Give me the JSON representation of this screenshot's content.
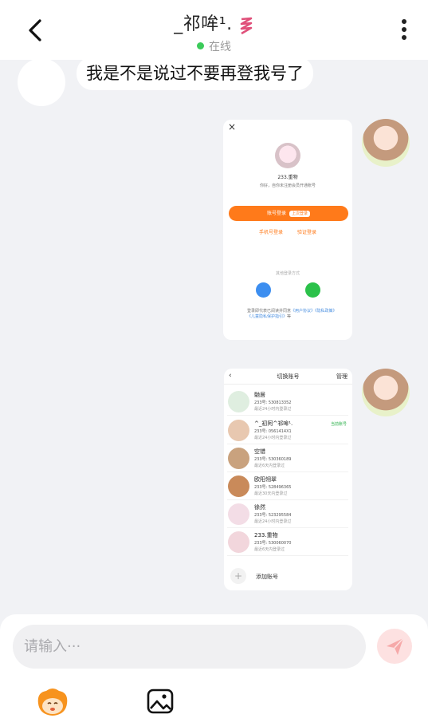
{
  "header": {
    "title": "_祁哞¹.",
    "status": "在线"
  },
  "messages": {
    "incoming_text": "我是不是说过不要再登我号了"
  },
  "screenshot1": {
    "close": "×",
    "name": "233.重物",
    "note": "你好，自你未注册会员开通账号",
    "primary_button": "账号登录",
    "primary_tag": "上次登录",
    "link_phone": "手机号登录",
    "link_verify": "验证登录",
    "other_login": "其他登录方式",
    "legal_prefix": "登录即代表已阅读并同意",
    "legal_links": "《用户协议》《隐私政策》《儿童隐私保护指引》",
    "legal_suffix": "等"
  },
  "screenshot2": {
    "back": "‹",
    "title": "切换账号",
    "manage": "管理",
    "accounts": [
      {
        "name": "馳居",
        "id": "233号: 530813352",
        "time": "最近24小时内登录过",
        "current": ""
      },
      {
        "name": "^_初阿^祁哞¹.",
        "id": "233号: 0561414X1",
        "time": "最近24小时内登录过",
        "current": "当前账号"
      },
      {
        "name": "空错",
        "id": "233号: 530360189",
        "time": "最近6天内登录过",
        "current": ""
      },
      {
        "name": "欧阳翎翠",
        "id": "233号: 528496365",
        "time": "最近30天内登录过",
        "current": ""
      },
      {
        "name": "徐然",
        "id": "233号: 523295584",
        "time": "最近24小时内登录过",
        "current": ""
      },
      {
        "name": "233.重物",
        "id": "233号: 530060070",
        "time": "最近6天内登录过",
        "current": ""
      }
    ],
    "add_account": "添加账号"
  },
  "composer": {
    "placeholder": "请输入···"
  },
  "icons": {
    "back": "chevron-left-icon",
    "more": "more-vertical-icon",
    "send": "send-icon",
    "emoji": "mascot-emoji-icon",
    "image": "image-icon"
  },
  "colors": {
    "online": "#3ccb5a",
    "send_bg": "#fde1e1",
    "accent_orange": "#ff7a1a"
  }
}
